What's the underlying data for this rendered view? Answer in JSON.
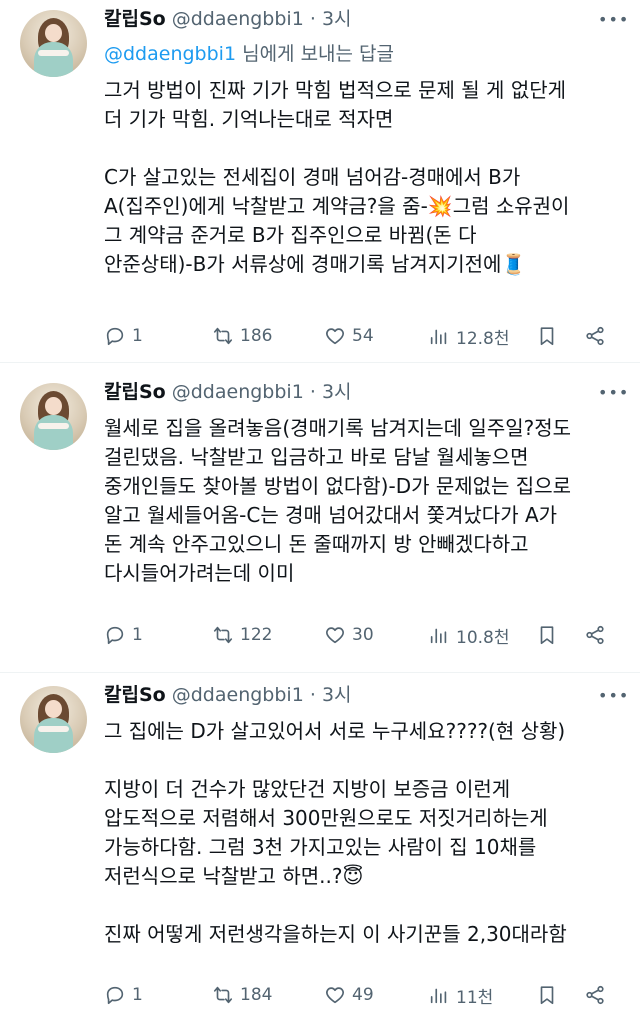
{
  "tweets": [
    {
      "name": "칼립So",
      "handle": "@ddaengbbi1",
      "time": "3시",
      "reply_to": {
        "handle": "@ddaengbbi1",
        "suffix": " 님에게 보내는 답글"
      },
      "lines": [
        "그거 방법이 진짜 기가 막힘 법적으로 문제 될 게 없단게",
        "더 기가 막힘. 기억나는대로 적자면",
        "",
        "C가 살고있는 전세집이 경매 넘어감-경매에서 B가",
        "A(집주인)에게 낙찰받고 계약금?을 줌-💥그럼 소유권이",
        "그 계약금 준거로 B가 집주인으로 바뀜(돈 다",
        "안준상태)-B가 서류상에 경매기록 남겨지기전에🧵"
      ],
      "stats": {
        "replies": "1",
        "retweets": "186",
        "likes": "54",
        "views": "12.8천"
      }
    },
    {
      "name": "칼립So",
      "handle": "@ddaengbbi1",
      "time": "3시",
      "lines": [
        "월세로 집을 올려놓음(경매기록 남겨지는데 일주일?정도",
        "걸린댔음. 낙찰받고 입금하고 바로 담날 월세놓으면",
        "중개인들도 찾아볼 방법이 없다함)-D가 문제없는 집으로",
        "알고 월세들어옴-C는 경매 넘어갔대서 쫓겨났다가 A가",
        "돈 계속 안주고있으니 돈 줄때까지 방 안빼겠다하고",
        "다시들어가려는데 이미"
      ],
      "stats": {
        "replies": "1",
        "retweets": "122",
        "likes": "30",
        "views": "10.8천"
      }
    },
    {
      "name": "칼립So",
      "handle": "@ddaengbbi1",
      "time": "3시",
      "lines": [
        "그 집에는 D가 살고있어서 서로 누구세요????(현 상황)",
        "",
        "지방이 더 건수가 많았단건 지방이 보증금 이런게",
        "압도적으로 저렴해서 300만원으로도 저짓거리하는게",
        "가능하다함. 그럼 3천 가지고있는 사람이 집 10채를",
        "저런식으로 낙찰받고 하면..?😇",
        "",
        "진짜 어떻게 저런생각을하는지 이 사기꾼들 2,30대라함"
      ],
      "stats": {
        "replies": "1",
        "retweets": "184",
        "likes": "49",
        "views": "11천"
      }
    }
  ],
  "icons": [
    "more-icon",
    "reply-icon",
    "retweet-icon",
    "like-icon",
    "views-icon",
    "bookmark-icon",
    "share-icon"
  ]
}
